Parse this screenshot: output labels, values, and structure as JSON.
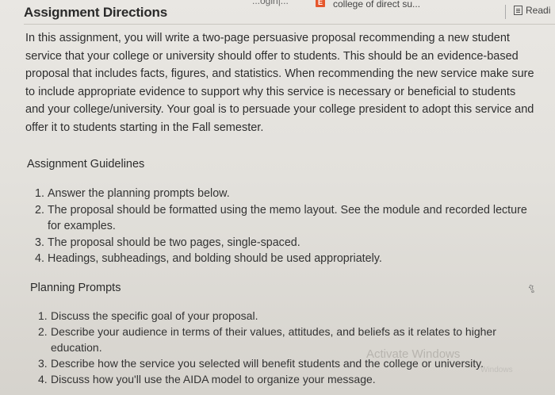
{
  "header": {
    "title": "Assignment Directions",
    "tab_partial": "...ogin|...",
    "tab_icon": "E",
    "tab_label": "college of direct su...",
    "reader_label": "Readi"
  },
  "intro_lines": [
    "In this assignment, you will write a two-page persuasive proposal recommending a new student",
    "service that your college or university should offer to students. This should be an evidence-based",
    "proposal that includes facts, figures, and statistics. When recommending the new service make sure",
    "to include appropriate evidence to support why this service is necessary or beneficial to students",
    "and your college/university. Your goal is to persuade your college president to adopt this service and",
    "offer it to students starting in the Fall semester."
  ],
  "guidelines": {
    "heading": "Assignment Guidelines",
    "items": [
      {
        "num": "1.",
        "line1": "Answer the planning prompts below.",
        "line2": ""
      },
      {
        "num": "2.",
        "line1": "The proposal should be formatted using the memo layout. See the module and recorded lecture",
        "line2": "for examples."
      },
      {
        "num": "3.",
        "line1": "The proposal should be two pages, single-spaced.",
        "line2": ""
      },
      {
        "num": "4.",
        "line1": "Headings, subheadings, and bolding should be used appropriately.",
        "line2": ""
      }
    ]
  },
  "prompts": {
    "heading": "Planning Prompts",
    "items": [
      {
        "num": "1.",
        "line1": "Discuss the specific goal of your proposal.",
        "line2": ""
      },
      {
        "num": "2.",
        "line1": "Describe your audience in terms of their values, attitudes, and beliefs as it relates to higher",
        "line2": "education."
      },
      {
        "num": "3.",
        "line1": "Describe how the service you selected will benefit students and the college or university.",
        "line2": ""
      },
      {
        "num": "4.",
        "line1": "Discuss how you'll use the AIDA model to organize your message.",
        "line2": ""
      }
    ]
  },
  "watermark": {
    "line1": "Activate Windows",
    "line2": "Windows"
  }
}
